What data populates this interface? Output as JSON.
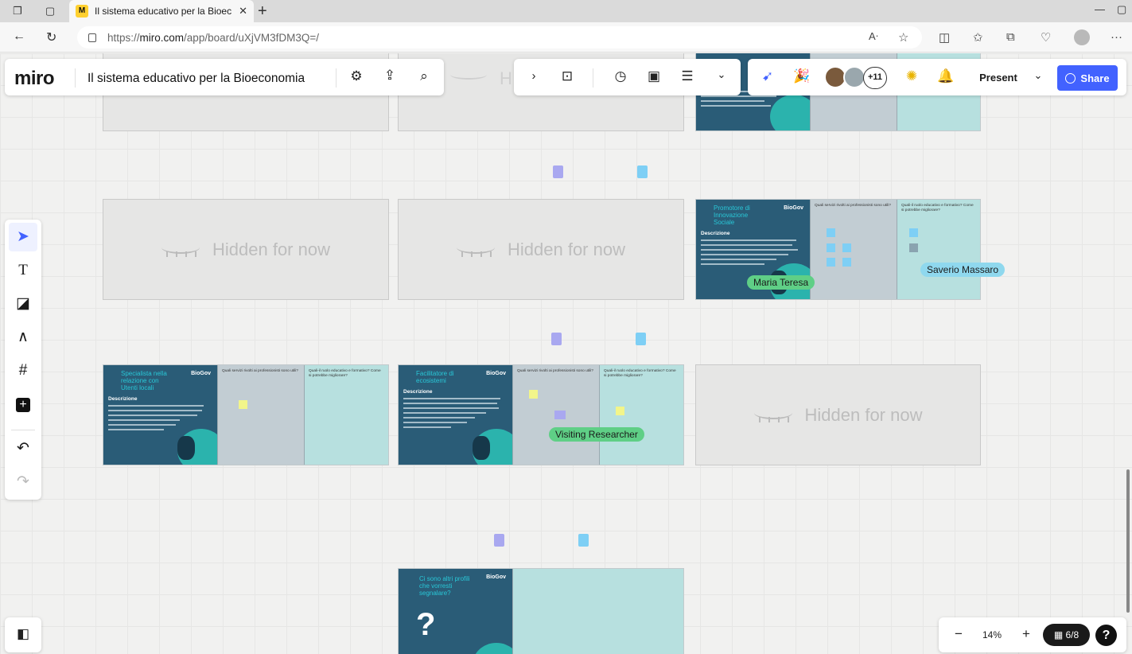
{
  "browser": {
    "tab_title": "Il sistema educativo per la Bioec",
    "url_prefix": "https://",
    "url_host": "miro.com",
    "url_path": "/app/board/uXjVM3fDM3Q=/"
  },
  "miro": {
    "logo": "miro",
    "board_title": "Il sistema educativo per la Bioeconomia",
    "collaborators_more": "+11",
    "present_label": "Present",
    "share_label": "Share",
    "zoom_level": "14%",
    "frames_counter": "6/8",
    "help_label": "?"
  },
  "frames": {
    "hidden_label": "Hidden for now",
    "partial_hidden_label": "H",
    "logo_text": "BioGov",
    "description_heading": "Descrizione",
    "question_1": "Quali servizi rivolti ai professionisti sono utili?",
    "question_2": "Quali-il ruolo educativo e formativo? Come si potrebbe migliorare?",
    "role_1_title": "Promotore di Innovazione Sociale",
    "role_2_title": "Specialista nella relazione con Utenti locali",
    "role_3_title": "Facilitatore di ecosistemi",
    "final_question": "Ci sono altri profili che vorresti segnalare?",
    "final_mark": "?"
  },
  "cursors": [
    {
      "name": "Maria Teresa",
      "color": "#5fcf86"
    },
    {
      "name": "Saverio Massaro",
      "color": "#8fd8ee"
    },
    {
      "name": "Visiting Researcher",
      "color": "#5fcf86"
    }
  ],
  "colors": {
    "accent": "#4262ff",
    "frame_teal_dark": "#2a5c77",
    "frame_teal_light": "#b7e0df",
    "sticky_yellow": "#f2f58a",
    "sticky_blue": "#7ecff5",
    "sticky_purple": "#a9a8f0"
  }
}
